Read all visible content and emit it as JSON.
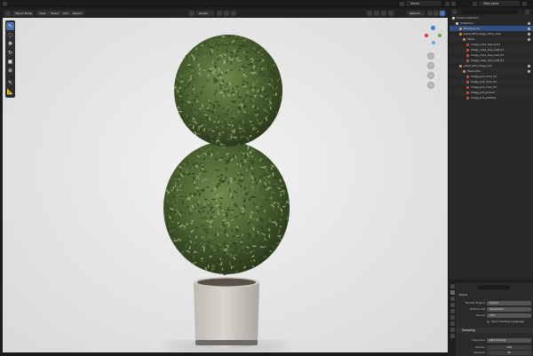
{
  "topbar": {
    "scene_label": "Scene",
    "view_layer_label": "View Layer"
  },
  "viewport_header": {
    "mode": "Object Mode",
    "menus": [
      "View",
      "Select",
      "Add",
      "Object"
    ],
    "orientation": "Global",
    "camera_label": "Options"
  },
  "viewport": {
    "info_lines": [
      "",
      "",
      ""
    ]
  },
  "toolbar": {
    "tools": [
      {
        "name": "cursor-tool-icon",
        "glyph": "↖",
        "active": true
      },
      {
        "name": "select-box-icon",
        "glyph": "◌",
        "active": false
      },
      {
        "name": "move-tool-icon",
        "glyph": "✥",
        "active": false
      },
      {
        "name": "rotate-tool-icon",
        "glyph": "↻",
        "active": false
      },
      {
        "name": "scale-tool-icon",
        "glyph": "▣",
        "active": false
      },
      {
        "name": "transform-tool-icon",
        "glyph": "⊕",
        "active": false
      },
      {
        "name": "annotate-tool-icon",
        "glyph": "✎",
        "active": false
      },
      {
        "name": "measure-tool-icon",
        "glyph": "📐",
        "active": false
      }
    ]
  },
  "outliner": {
    "title": "Scene Collection",
    "rows": [
      {
        "label": "Collection",
        "indent": 1,
        "color": "#d0d0d0",
        "selected": false
      },
      {
        "label": "Background",
        "indent": 2,
        "color": "#d09a3a",
        "selected": true
      },
      {
        "label": "plant_003_Ciagg_Olive_tree",
        "indent": 2,
        "color": "#e6823c",
        "selected": false
      },
      {
        "label": "Plane",
        "indent": 3,
        "color": "#e6823c",
        "selected": false
      },
      {
        "label": "Ciagg_olive_tree_bark",
        "indent": 4,
        "color": "#c94a4a",
        "selected": false
      },
      {
        "label": "Ciagg_olive_tree_leaf_01",
        "indent": 4,
        "color": "#c94a4a",
        "selected": false
      },
      {
        "label": "Ciagg_olive_tree_leaf_02",
        "indent": 4,
        "color": "#c94a4a",
        "selected": false
      },
      {
        "label": "Ciagg_olive_tree_leaf_03",
        "indent": 4,
        "color": "#c94a4a",
        "selected": false
      },
      {
        "label": "plant_003_Ciagg_pot",
        "indent": 2,
        "color": "#e6823c",
        "selected": false
      },
      {
        "label": "Plane.001",
        "indent": 3,
        "color": "#e6823c",
        "selected": false
      },
      {
        "label": "Ciagg_pot_color_01",
        "indent": 4,
        "color": "#c94a4a",
        "selected": false
      },
      {
        "label": "Ciagg_pot_color_02",
        "indent": 4,
        "color": "#c94a4a",
        "selected": false
      },
      {
        "label": "Ciagg_pot_color_03",
        "indent": 4,
        "color": "#c94a4a",
        "selected": false
      },
      {
        "label": "Ciagg_pot_ground",
        "indent": 4,
        "color": "#c94a4a",
        "selected": false
      },
      {
        "label": "Ciagg_pot_pebbles",
        "indent": 4,
        "color": "#c94a4a",
        "selected": false
      }
    ]
  },
  "properties": {
    "scene_name": "Scene",
    "render_engine_label": "Render Engine",
    "render_engine": "Cycles",
    "feature_set_label": "Feature Set",
    "feature_set": "Supported",
    "device_label": "Device",
    "device": "CPU",
    "osl_label": "Open Shading Language",
    "sampling_title": "Sampling",
    "integrator_label": "Integrator",
    "integrator": "Path Tracing",
    "render_samples_label": "Render",
    "render_samples": "128",
    "viewport_samples_label": "Viewport",
    "viewport_samples": "32"
  },
  "colors": {
    "accent": "#4772b3",
    "selection": "#334d80",
    "object_orange": "#e6823c",
    "material_red": "#c94a4a"
  }
}
